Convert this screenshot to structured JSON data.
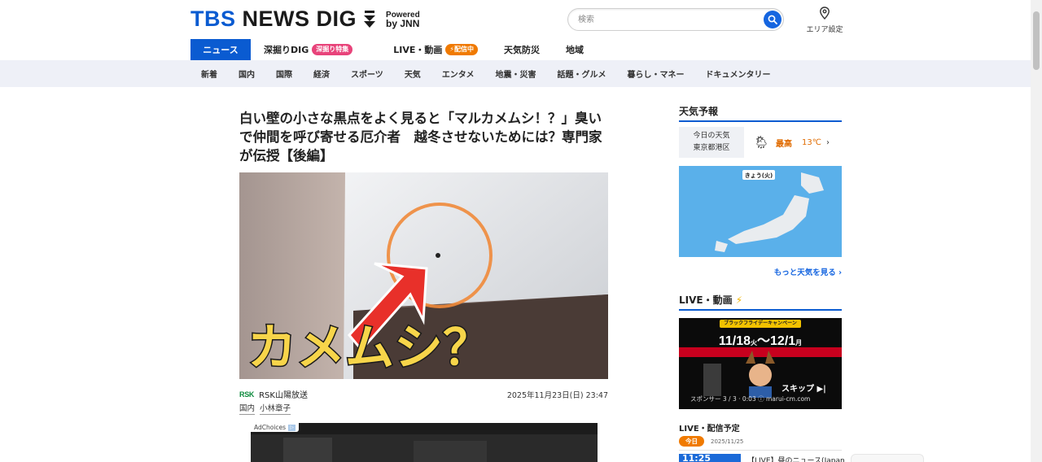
{
  "header": {
    "logo": {
      "brand": "TBS",
      "name": "NEWS DIG",
      "powered": "Powered",
      "by": "by JNN"
    },
    "search": {
      "placeholder": "検索"
    },
    "area": {
      "label": "エリア設定"
    }
  },
  "nav": {
    "main": [
      {
        "label": "ニュース",
        "active": true
      },
      {
        "label": "深掘りDIG",
        "badge": "深掘り特集"
      },
      {
        "label": "LIVE・動画",
        "badge": "配信中"
      },
      {
        "label": "天気防災"
      },
      {
        "label": "地域"
      }
    ],
    "sub": [
      "新着",
      "国内",
      "国際",
      "経済",
      "スポーツ",
      "天気",
      "エンタメ",
      "地震・災害",
      "話題・グルメ",
      "暮らし・マネー",
      "ドキュメンタリー"
    ]
  },
  "article": {
    "headline": "白い壁の小さな黒点をよく見ると「マルカメムシ！？」臭いで仲間を呼び寄せる厄介者　越冬させないためには？専門家が伝授【後編】",
    "image_caption": "カメムシ？",
    "source_logo": "RSK",
    "source": "RSK山陽放送",
    "date": "2025年11月23日(日) 23:47",
    "tags": [
      "国内",
      "小林章子"
    ],
    "ad_choices": "AdChoices"
  },
  "sidebar": {
    "weather": {
      "title": "天気予報",
      "label": "今日の天気",
      "location": "東京都港区",
      "high_label": "最高",
      "temp": "13℃",
      "map_label": "きょう(火)",
      "more": "もっと天気を見る"
    },
    "live": {
      "title": "LIVE・動画",
      "banner": "ブラックフライデーキャンペーン",
      "dates": "11/18",
      "dates_small": "火",
      "dates_sep": "〜",
      "dates_end": "12/1",
      "dates_end_small": "月",
      "skip": "スキップ ▶|",
      "sponsor": "スポンサー 3 / 3 · 0:03  ⓘ marui-cm.com"
    },
    "schedule": {
      "title": "LIVE・配信予定",
      "today": "今日",
      "date": "2025/11/25",
      "first_time": "11:25",
      "first_title": "【LIVE】昼のニュース(Japan"
    }
  },
  "colors": {
    "accent": "#0a5bd1",
    "orange": "#f07a00",
    "pink": "#e8437a"
  }
}
